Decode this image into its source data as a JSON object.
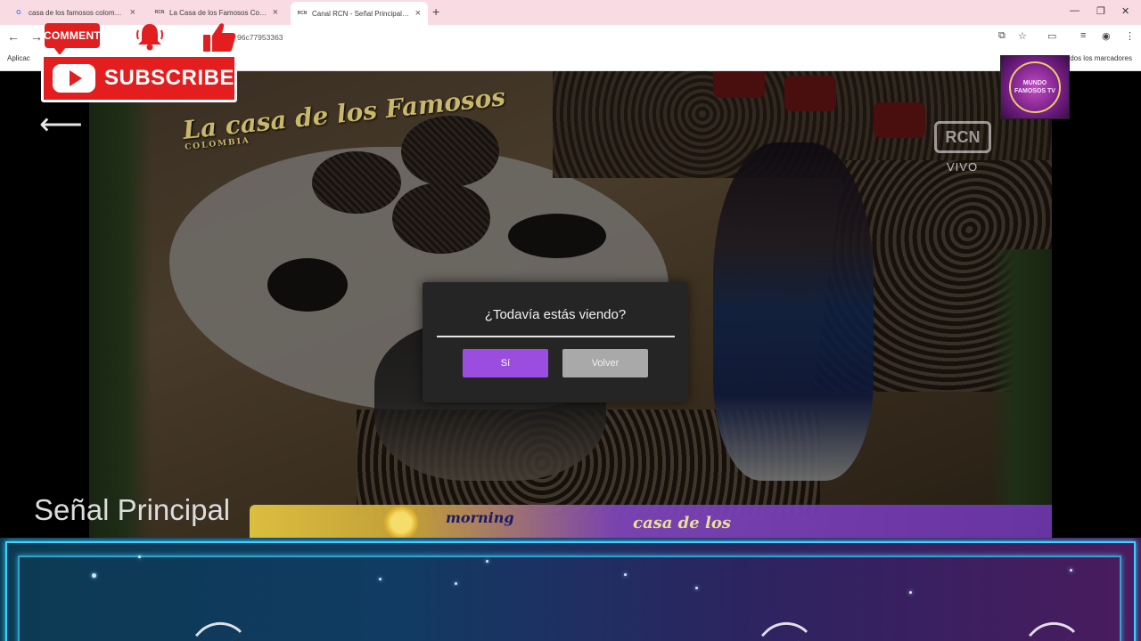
{
  "browser": {
    "tabs": [
      {
        "title": "casa de los famosos colombia -",
        "favicon": "G",
        "active": false
      },
      {
        "title": "La Casa de los Famosos Colom",
        "favicon": "RCN",
        "active": false
      },
      {
        "title": "Canal RCN - Señal Principal - m",
        "favicon": "RCN",
        "active": true
      }
    ],
    "new_tab": "+",
    "url": "96c77953363",
    "bookmarks": {
      "apps": "Aplicac",
      "other": "dos los marcadores"
    }
  },
  "overlays": {
    "comment": "COMMENT",
    "subscribe": "SUBSCRIBE",
    "channel_logo": {
      "top": "MUNDO",
      "bottom": "FAMOSOS TV"
    }
  },
  "video": {
    "show_logo": {
      "main": "La casa de los Famosos",
      "sub": "COLOMBIA"
    },
    "live_label": "VIVO",
    "channel_title": "Señal Principal",
    "banner": {
      "morning": "morning",
      "casa": "casa de los"
    }
  },
  "dialog": {
    "title": "¿Todavía estás viendo?",
    "yes_label": "Sí",
    "back_label": "Volver"
  },
  "colors": {
    "dialog_bg": "#252525",
    "accent_purple": "#9b4de0",
    "subscribe_red": "#e41e1e"
  }
}
